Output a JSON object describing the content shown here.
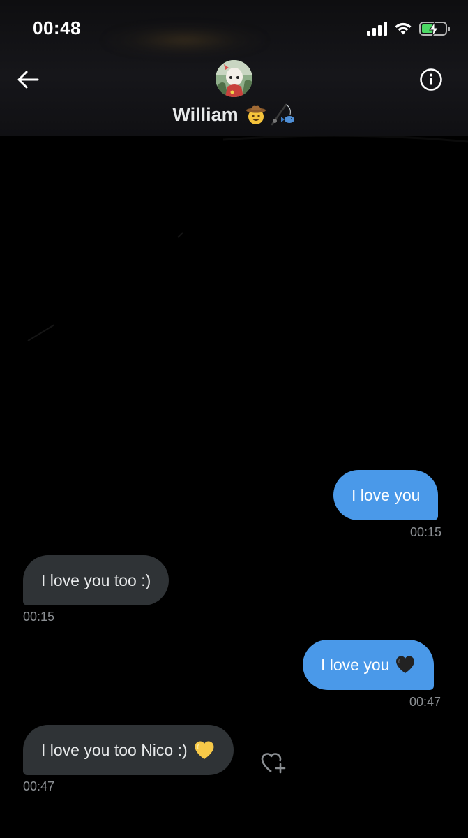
{
  "status_bar": {
    "time": "00:48"
  },
  "header": {
    "contact_name": "William",
    "name_emojis": [
      "cowboy-face-emoji",
      "fishing-pole-emoji"
    ]
  },
  "messages": [
    {
      "direction": "outgoing",
      "text": "I love you",
      "time": "00:15"
    },
    {
      "direction": "incoming",
      "text": "I love you too :)",
      "time": "00:15"
    },
    {
      "direction": "outgoing",
      "text": "I love you",
      "emoji": "black-heart",
      "time": "00:47"
    },
    {
      "direction": "incoming",
      "text": "I love you too Nico :)",
      "emoji": "yellow-heart",
      "time": "00:47"
    }
  ],
  "colors": {
    "background": "#000000",
    "outgoing_bubble": "#4a99e9",
    "incoming_bubble": "#2f3336",
    "timestamp": "#8b8f93",
    "battery_fill": "#4cd964"
  }
}
